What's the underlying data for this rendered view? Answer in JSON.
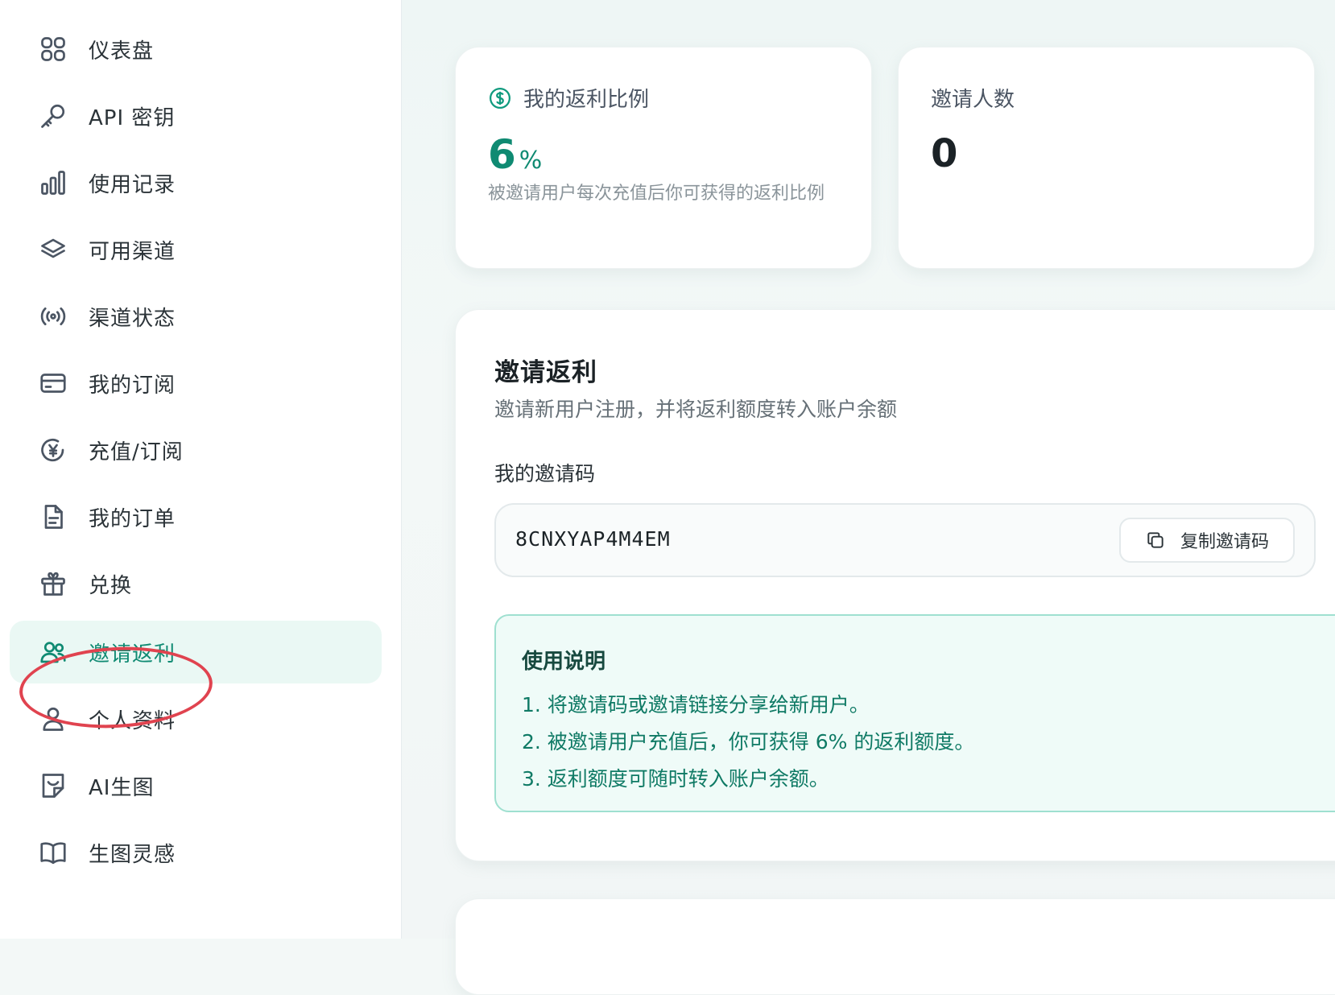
{
  "sidebar": {
    "items": [
      {
        "label": "仪表盘",
        "icon": "dashboard-grid-icon",
        "active": false
      },
      {
        "label": "API 密钥",
        "icon": "key-icon",
        "active": false
      },
      {
        "label": "使用记录",
        "icon": "bar-chart-icon",
        "active": false
      },
      {
        "label": "可用渠道",
        "icon": "layers-icon",
        "active": false
      },
      {
        "label": "渠道状态",
        "icon": "broadcast-icon",
        "active": false
      },
      {
        "label": "我的订阅",
        "icon": "credit-card-icon",
        "active": false
      },
      {
        "label": "充值/订阅",
        "icon": "yen-coin-icon",
        "active": false
      },
      {
        "label": "我的订单",
        "icon": "document-icon",
        "active": false
      },
      {
        "label": "兑换",
        "icon": "gift-icon",
        "active": false
      },
      {
        "label": "邀请返利",
        "icon": "users-icon",
        "active": true
      },
      {
        "label": "个人资料",
        "icon": "user-icon",
        "active": false
      },
      {
        "label": "AI生图",
        "icon": "image-sticker-icon",
        "active": false
      },
      {
        "label": "生图灵感",
        "icon": "book-icon",
        "active": false
      }
    ]
  },
  "stats": {
    "rebate_rate": {
      "title": "我的返利比例",
      "value": "6",
      "unit": "%",
      "description": "被邀请用户每次充值后你可获得的返利比例"
    },
    "invite_count": {
      "title": "邀请人数",
      "value": "0"
    }
  },
  "invite": {
    "title": "邀请返利",
    "subtitle": "邀请新用户注册，并将返利额度转入账户余额",
    "code_label": "我的邀请码",
    "code": "8CNXYAP4M4EM",
    "copy_label": "复制邀请码",
    "notes_title": "使用说明",
    "notes": [
      "1. 将邀请码或邀请链接分享给新用户。",
      "2. 被邀请用户充值后，你可获得 6% 的返利额度。",
      "3. 返利额度可随时转入账户余额。"
    ]
  },
  "colors": {
    "accent": "#0f8a72",
    "active_bg": "#eaf8f4",
    "annotation_ring": "#e0434f",
    "notes_border": "#9fe0d0"
  }
}
